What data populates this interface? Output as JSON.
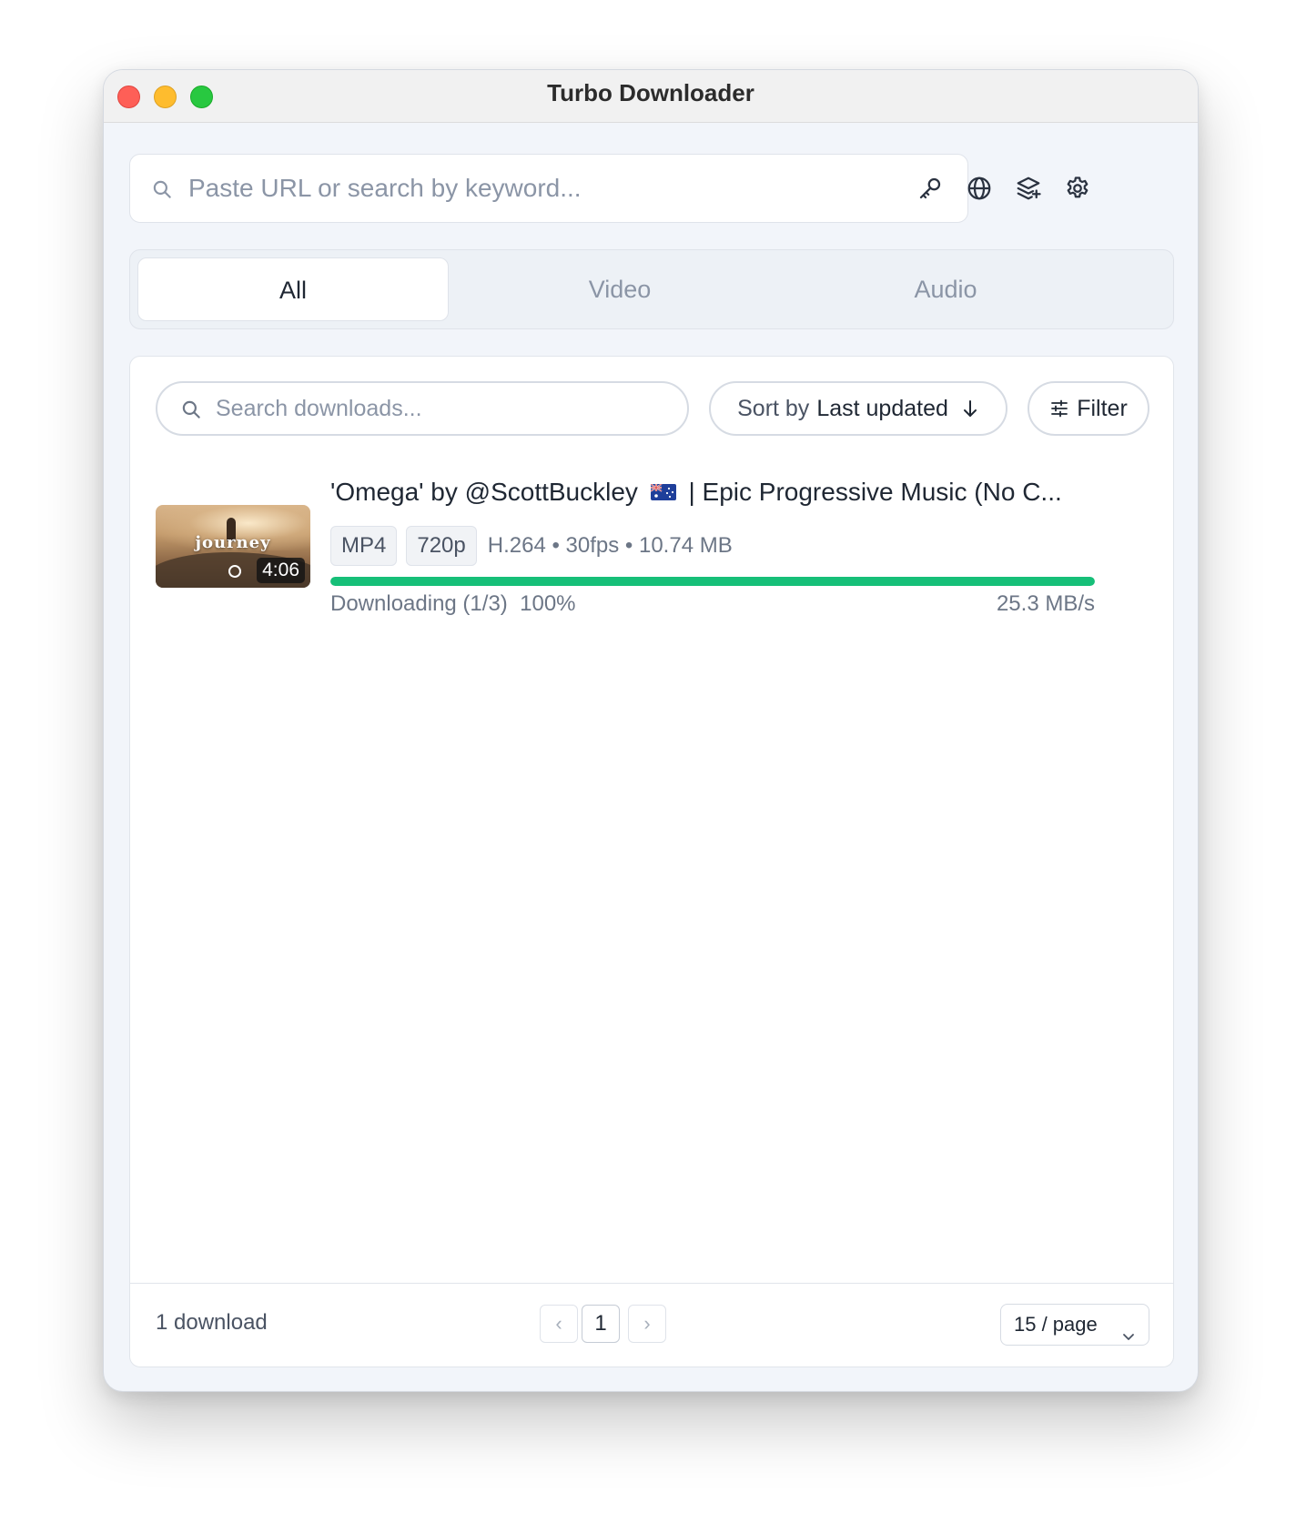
{
  "window": {
    "title": "Turbo Downloader"
  },
  "url_bar": {
    "placeholder": "Paste URL or search by keyword..."
  },
  "toolbar": {
    "icons": [
      "key-icon",
      "globe-icon",
      "layers-icon",
      "gear-icon"
    ]
  },
  "tabs": [
    {
      "label": "All",
      "active": true
    },
    {
      "label": "Video",
      "active": false
    },
    {
      "label": "Audio",
      "active": false
    }
  ],
  "downloads_toolbar": {
    "search_placeholder": "Search downloads...",
    "sort_prefix": "Sort by",
    "sort_value": "Last updated",
    "filter_label": "Filter"
  },
  "items": [
    {
      "title_part1": "'Omega' by @ScottBuckley",
      "title_part2": "| Epic Progressive Music (No C...",
      "thumbnail_text": "journey",
      "duration": "4:06",
      "format": "MP4",
      "resolution": "720p",
      "specs": "H.264 • 30fps • 10.74 MB",
      "status": "Downloading (1/3)",
      "percent": "100%",
      "progress": 1.0,
      "speed": "25.3 MB/s"
    }
  ],
  "footer": {
    "count": "1 download",
    "prev": "‹",
    "page": "1",
    "next": "›",
    "page_size": "15 / page"
  },
  "colors": {
    "accent_progress": "#16bf78",
    "close": "#fe5f57",
    "minimize": "#febc2e",
    "zoom": "#28c840"
  }
}
